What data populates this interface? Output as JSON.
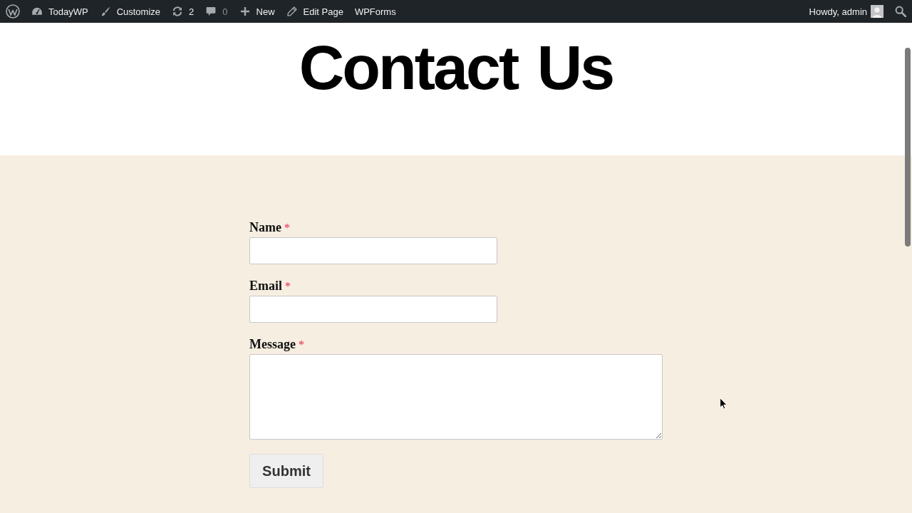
{
  "admin_bar": {
    "items": [
      {
        "kind": "dashboard",
        "label": "TodayWP",
        "disabled": false
      },
      {
        "kind": "customize",
        "label": "Customize",
        "disabled": false
      },
      {
        "kind": "updates",
        "label": "2",
        "disabled": false
      },
      {
        "kind": "comments",
        "label": "0",
        "disabled": true
      },
      {
        "kind": "new",
        "label": "New",
        "disabled": false
      },
      {
        "kind": "edit",
        "label": "Edit Page",
        "disabled": false
      },
      {
        "kind": "plain",
        "label": "WPForms",
        "disabled": false
      }
    ],
    "account": {
      "greeting": "Howdy, admin"
    }
  },
  "page": {
    "title": "Contact Us"
  },
  "form": {
    "required_mark": "*",
    "fields": [
      {
        "kind": "text",
        "label": "Name",
        "required": true
      },
      {
        "kind": "email",
        "label": "Email",
        "required": true
      },
      {
        "kind": "textarea",
        "label": "Message",
        "required": true
      }
    ],
    "submit": "Submit"
  }
}
